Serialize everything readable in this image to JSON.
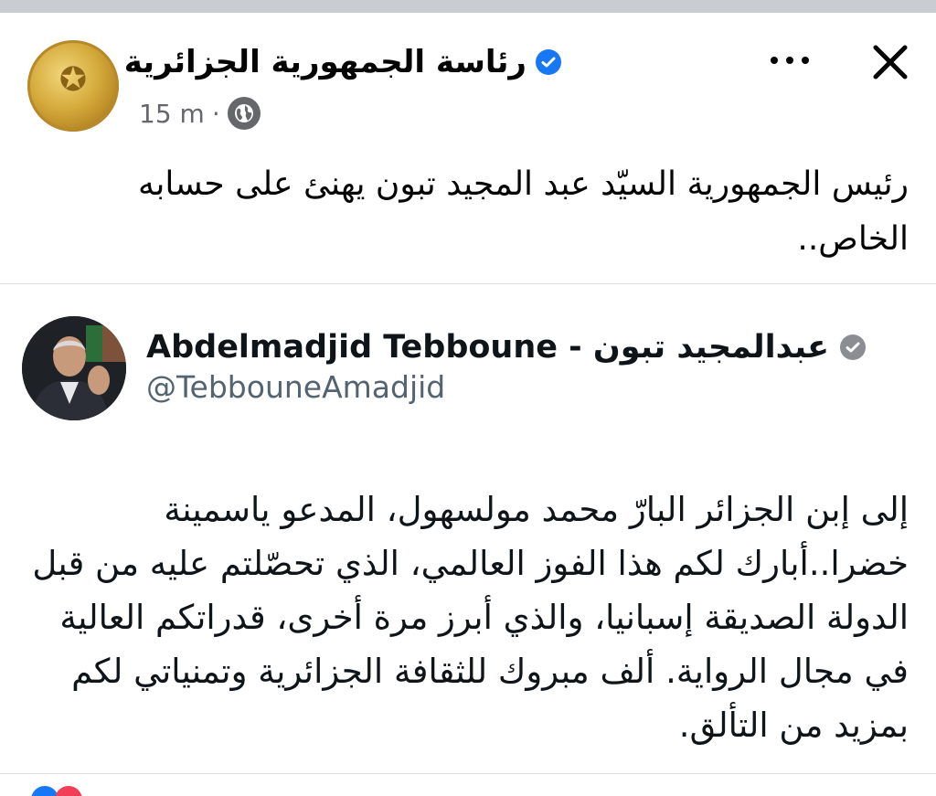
{
  "post": {
    "page_name": "رئاسة الجمهورية الجزائرية",
    "time": "15 m",
    "separator": "·",
    "text": "رئيس الجمهورية السيّد عبد المجيد تبون يهنئ على حسابه الخاص.."
  },
  "icons": {
    "more": "more-horizontal-icon",
    "close": "close-icon",
    "verified": "verified-badge-icon",
    "audience": "globe-icon"
  },
  "tweet": {
    "name": "Abdelmadjid Tebboune - عبدالمجيد تبون",
    "handle": "@TebbouneAmadjid",
    "text": "إلى إبن الجزائر البارّ محمد مولسهول، المدعو ياسمينة خضرا..أبارك لكم هذا الفوز العالمي، الذي تحصّلتم عليه من قبل الدولة الصديقة إسبانيا، والذي أبرز مرة أخرى، قدراتكم العالية في مجال الرواية. ألف مبروك للثقافة الجزائرية وتمنياتي لكم بمزيد من التألق."
  },
  "colors": {
    "facebook_blue": "#1877f2",
    "secondary_text": "#65676b",
    "twitter_secondary": "#536471"
  }
}
